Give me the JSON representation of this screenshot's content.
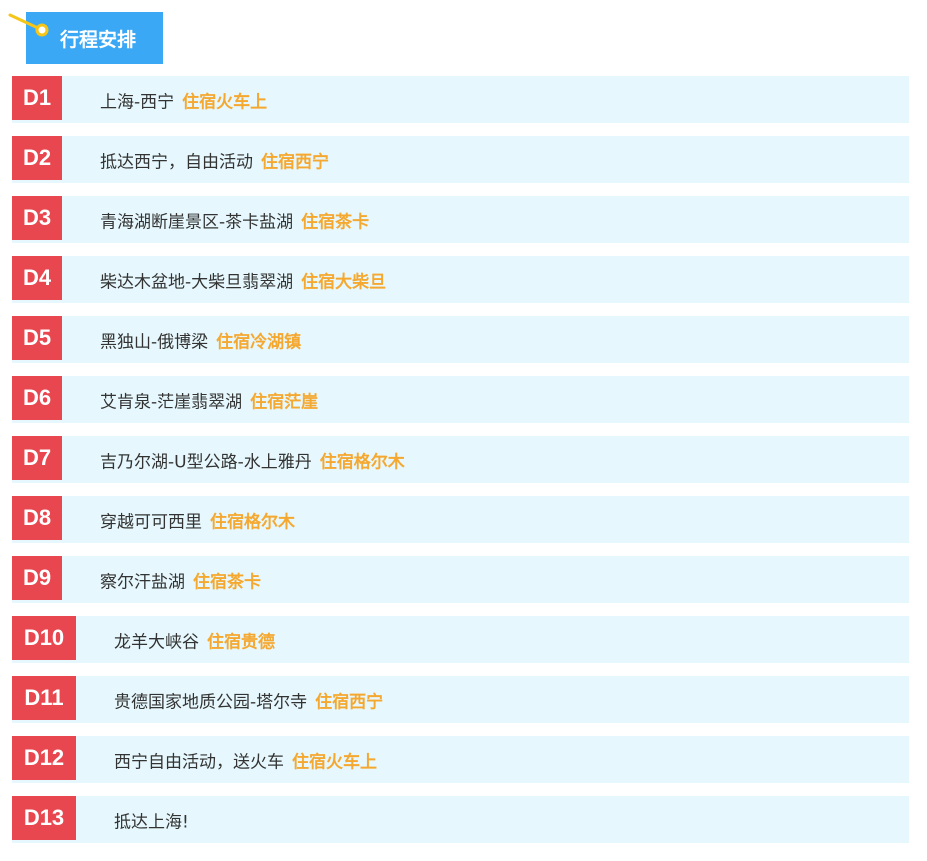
{
  "header": {
    "title": "行程安排"
  },
  "colors": {
    "header_bg": "#3aa8f5",
    "badge_bg": "#e8474f",
    "row_bg": "#e6f8fd",
    "stay_text": "#f5a830",
    "pin": "#f5c518"
  },
  "days": [
    {
      "day": "D1",
      "route": "上海-西宁",
      "stay": "住宿火车上"
    },
    {
      "day": "D2",
      "route": "抵达西宁，自由活动",
      "stay": "住宿西宁"
    },
    {
      "day": "D3",
      "route": "青海湖断崖景区-茶卡盐湖",
      "stay": "住宿茶卡"
    },
    {
      "day": "D4",
      "route": "柴达木盆地-大柴旦翡翠湖",
      "stay": "住宿大柴旦"
    },
    {
      "day": "D5",
      "route": "黑独山-俄博梁",
      "stay": "住宿冷湖镇"
    },
    {
      "day": "D6",
      "route": "艾肯泉-茫崖翡翠湖",
      "stay": "住宿茫崖"
    },
    {
      "day": "D7",
      "route": "吉乃尔湖-U型公路-水上雅丹",
      "stay": "住宿格尔木"
    },
    {
      "day": "D8",
      "route": "穿越可可西里",
      "stay": "住宿格尔木"
    },
    {
      "day": "D9",
      "route": "察尔汗盐湖",
      "stay": "住宿茶卡"
    },
    {
      "day": "D10",
      "route": "龙羊大峡谷",
      "stay": "住宿贵德"
    },
    {
      "day": "D11",
      "route": "贵德国家地质公园-塔尔寺",
      "stay": "住宿西宁"
    },
    {
      "day": "D12",
      "route": "西宁自由活动，送火车",
      "stay": "住宿火车上"
    },
    {
      "day": "D13",
      "route": "抵达上海!",
      "stay": ""
    }
  ]
}
